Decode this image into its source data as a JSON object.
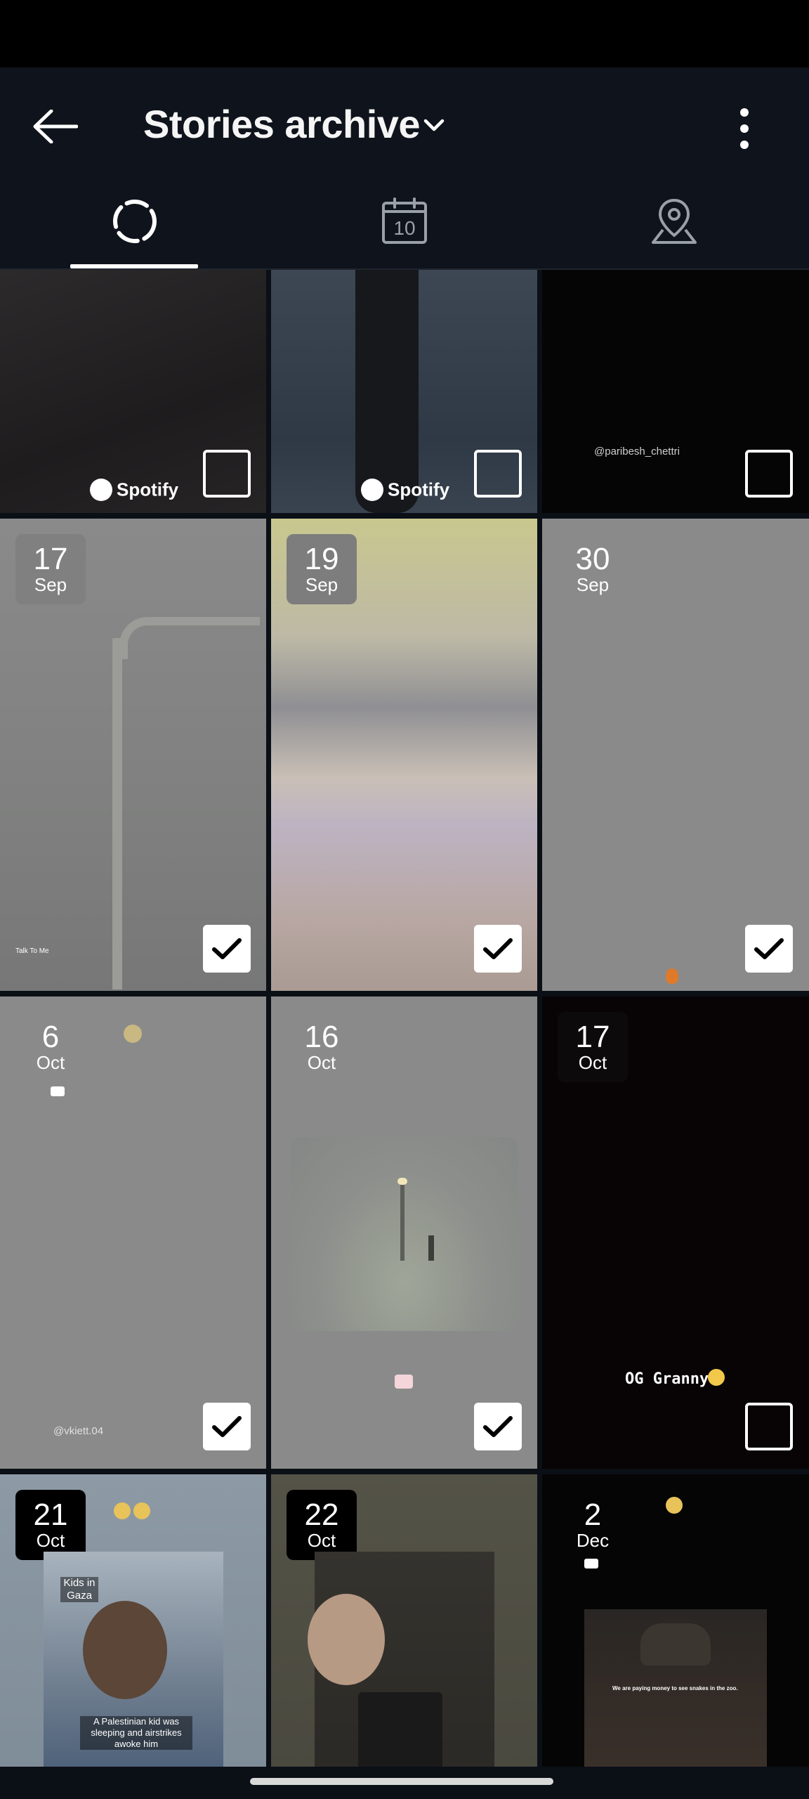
{
  "header": {
    "title": "Stories archive"
  },
  "tabs": [
    {
      "name": "stories",
      "icon": "story-ring-icon"
    },
    {
      "name": "calendar",
      "icon": "calendar-icon",
      "calendar_day": "10"
    },
    {
      "name": "map",
      "icon": "map-pin-icon"
    }
  ],
  "top_row": {
    "tile1": {
      "brand": "Spotify"
    },
    "tile2": {
      "brand": "Spotify"
    },
    "tile3": {
      "handle": "@paribesh_chettri"
    }
  },
  "rows": [
    [
      {
        "day": "17",
        "month": "Sep",
        "caption": "Talk To Me",
        "selected": true
      },
      {
        "day": "19",
        "month": "Sep",
        "selected": true
      },
      {
        "day": "30",
        "month": "Sep",
        "selected": true
      }
    ],
    [
      {
        "day": "6",
        "month": "Oct",
        "handle": "@vkiett.04",
        "selected": true
      },
      {
        "day": "16",
        "month": "Oct",
        "selected": true
      },
      {
        "day": "17",
        "month": "Oct",
        "caption": "OG Granny",
        "selected": false
      }
    ],
    [
      {
        "day": "21",
        "month": "Oct",
        "label": "Kids in Gaza",
        "caption": "A Palestinian kid was sleeping and airstrikes awoke him"
      },
      {
        "day": "22",
        "month": "Oct"
      },
      {
        "day": "2",
        "month": "Dec",
        "caption": "We are paying money to see snakes in the zoo."
      }
    ]
  ],
  "colors": {
    "background": "#0b0f16",
    "app_bar": "#0f141c",
    "check_fill": "#ffffff"
  }
}
